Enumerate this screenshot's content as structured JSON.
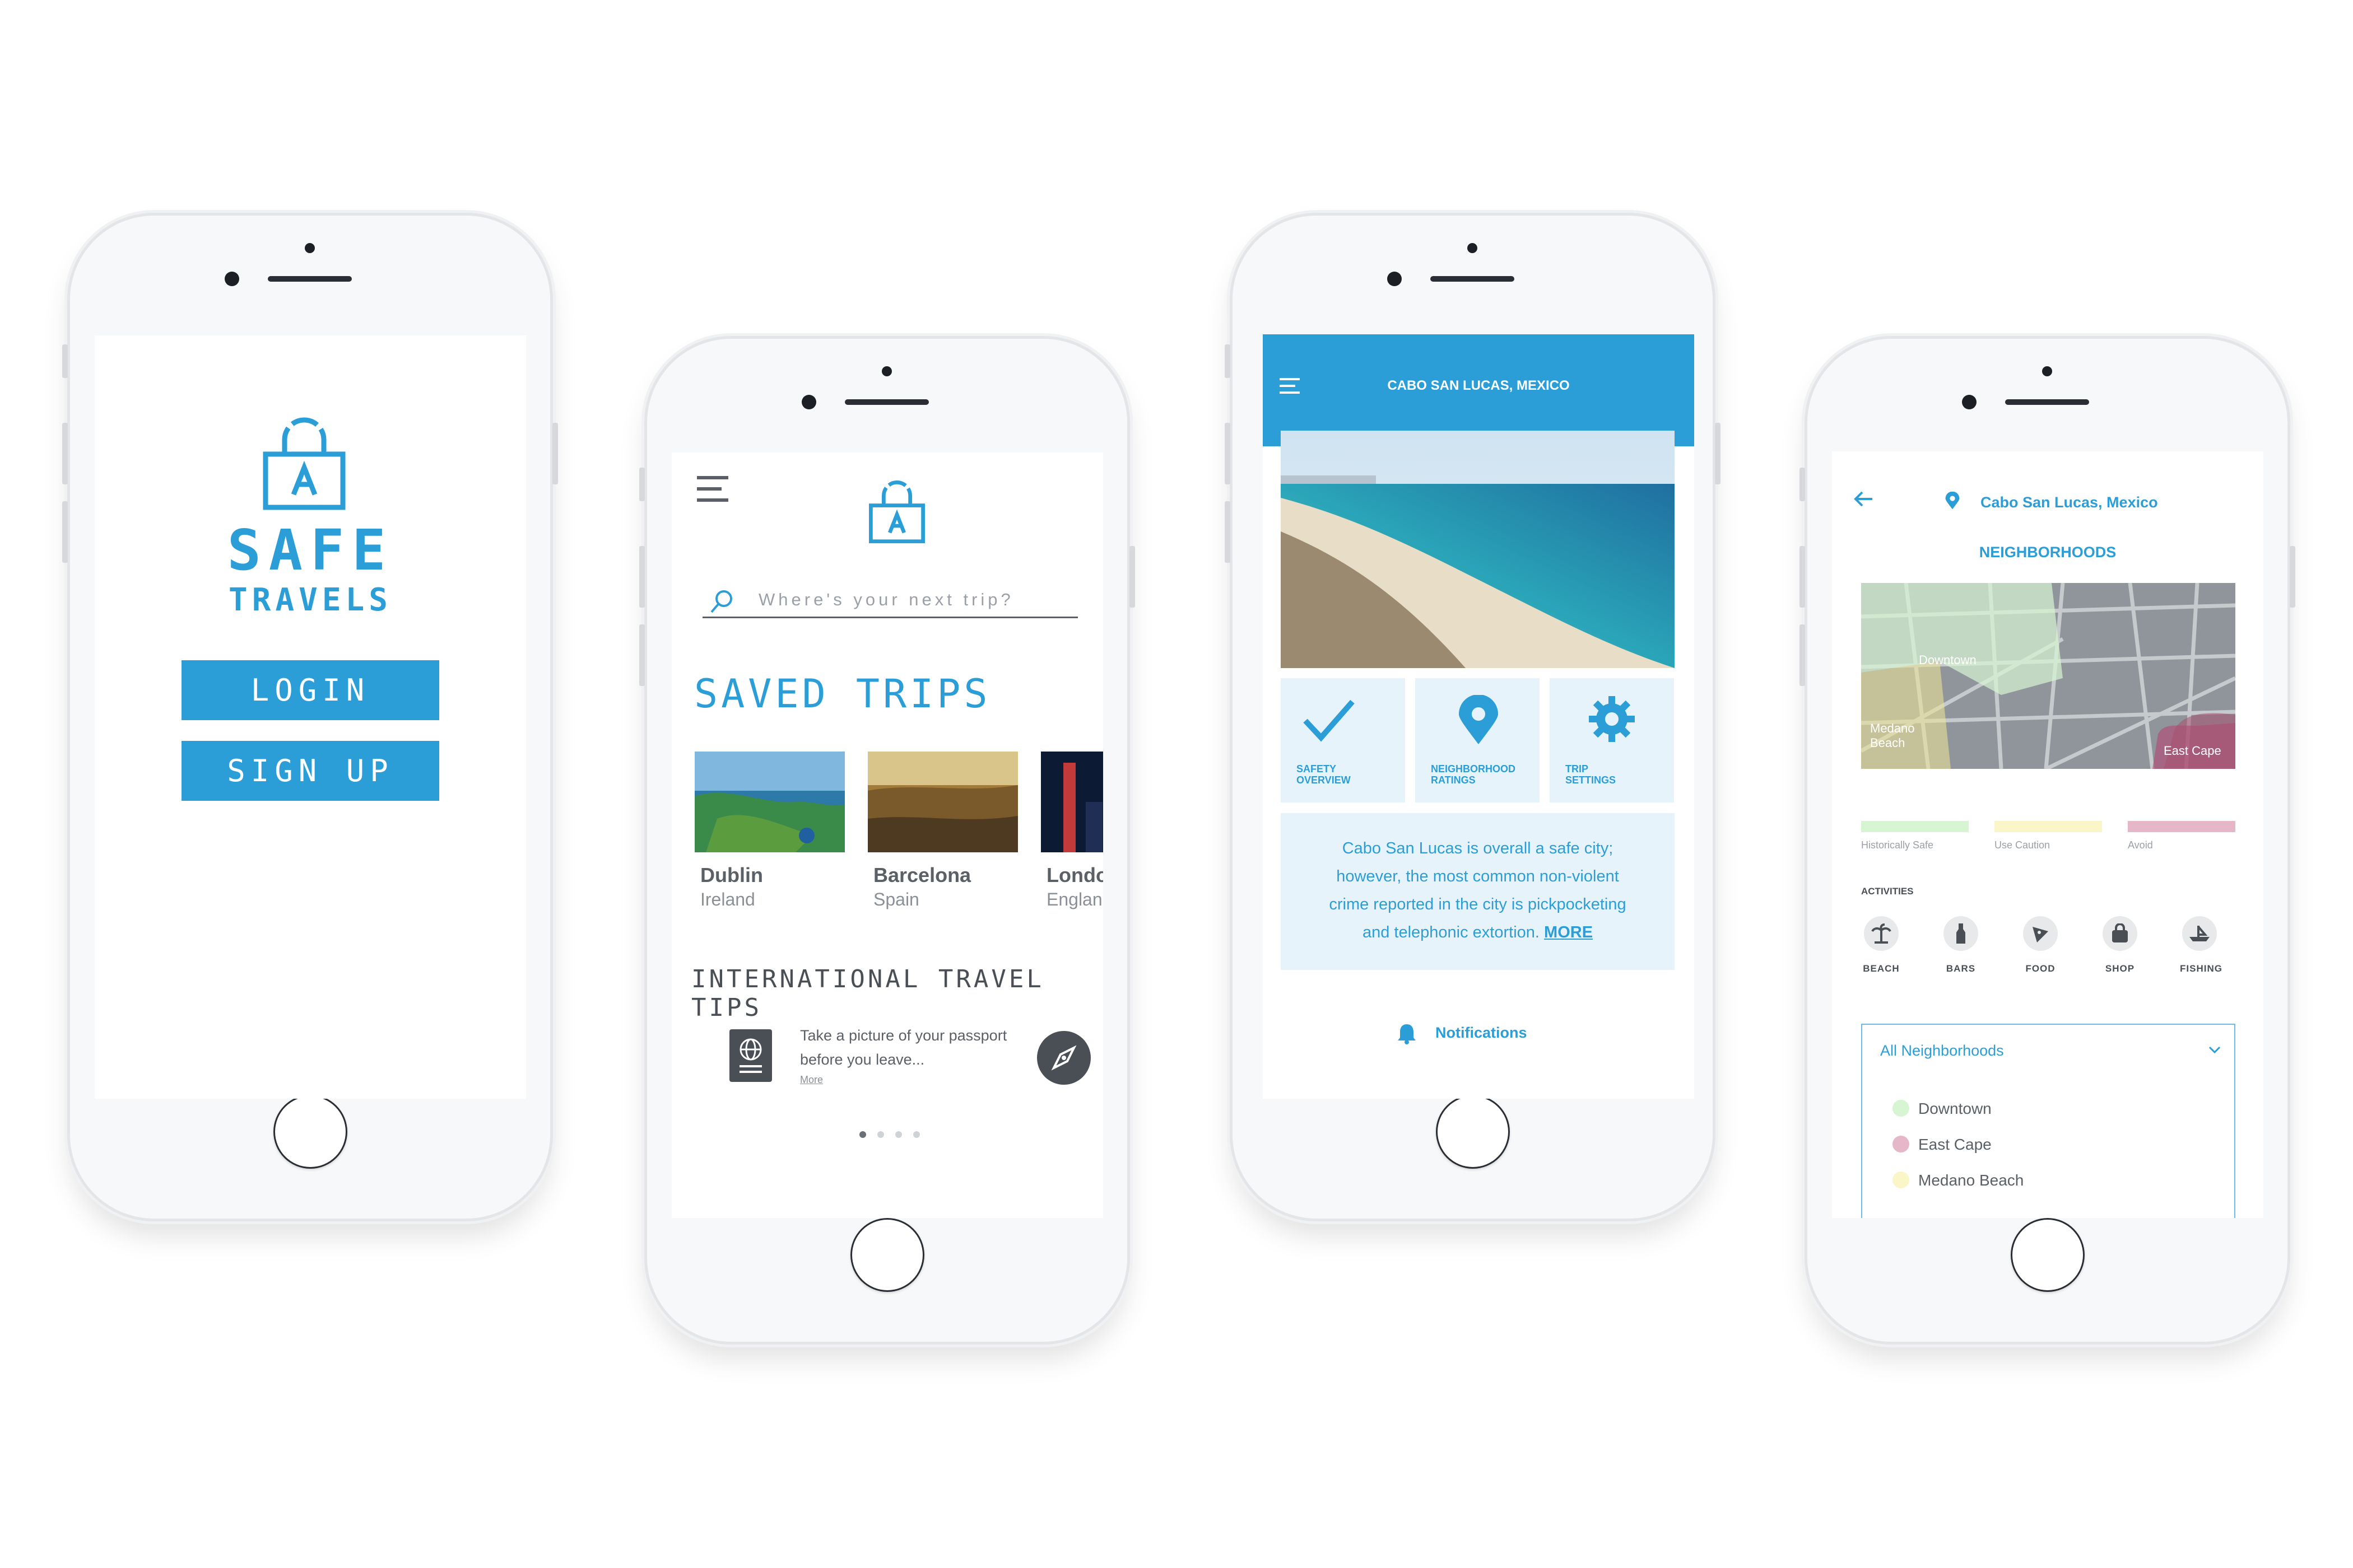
{
  "login": {
    "brand_line1": "SAFE",
    "brand_line2": "TRAVELS",
    "login_label": "LOGIN",
    "signup_label": "SIGN UP"
  },
  "home": {
    "search_placeholder": "Where's your next trip?",
    "saved_trips_title": "SAVED TRIPS",
    "trips": [
      {
        "city": "Dublin",
        "country": "Ireland"
      },
      {
        "city": "Barcelona",
        "country": "Spain"
      },
      {
        "city": "London",
        "country": "England"
      }
    ],
    "tips_title": "INTERNATIONAL TRAVEL TIPS",
    "tip_text": "Take a picture of your passport before you leave...",
    "tip_more": "More",
    "page_indicator": {
      "count": 4,
      "active": 1
    }
  },
  "overview": {
    "header_title": "CABO SAN LUCAS, MEXICO",
    "tiles": [
      {
        "label": "SAFETY\nOVERVIEW",
        "icon": "check-icon"
      },
      {
        "label": "NEIGHBORHOOD\nRATINGS",
        "icon": "location-pin-icon"
      },
      {
        "label": "TRIP\nSETTINGS",
        "icon": "gear-icon"
      }
    ],
    "summary": "Cabo San Lucas is overall a safe city; however, the most common non-violent crime reported in the city is pickpocketing and telephonic extortion.",
    "more_label": "MORE",
    "notifications_label": "Notifications"
  },
  "neighborhoods": {
    "location": "Cabo San Lucas, Mexico",
    "title": "NEIGHBORHOODS",
    "map_labels": {
      "downtown": "Downtown",
      "medano": "Medano\nBeach",
      "eastcape": "East Cape"
    },
    "legend": [
      {
        "label": "Historically Safe",
        "color": "#d7f5d3"
      },
      {
        "label": "Use Caution",
        "color": "#fbf6c8"
      },
      {
        "label": "Avoid",
        "color": "#e6b7c8"
      }
    ],
    "activities_title": "ACTIVITIES",
    "activities": [
      "BEACH",
      "BARS",
      "FOOD",
      "SHOP",
      "FISHING"
    ],
    "dropdown_value": "All Neighborhoods",
    "options": [
      {
        "label": "Downtown",
        "color": "#d7f5d3"
      },
      {
        "label": "East Cape",
        "color": "#e6b7c8"
      },
      {
        "label": "Medano Beach",
        "color": "#fbf6c8"
      }
    ]
  },
  "colors": {
    "accent": "#2b9ed8",
    "tile_bg": "#e7f3fb",
    "text_dark": "#4a4f55"
  }
}
